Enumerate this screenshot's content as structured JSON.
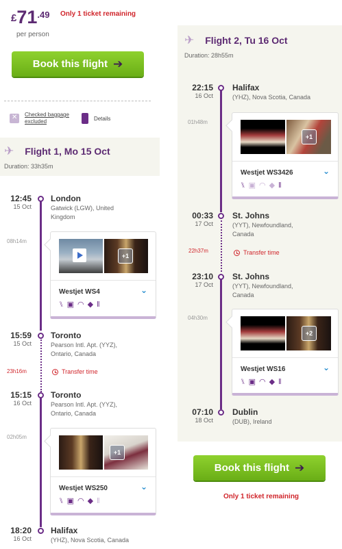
{
  "summary": {
    "currency": "£",
    "price_int": "71",
    "price_dec": ".49",
    "per_person": "per person",
    "remaining": "Only 1 ticket remaining",
    "book_label": "Book this flight",
    "book_arrow": "➔",
    "baggage": "Checked baggage excluded",
    "baggage_line1": "Checked baggage",
    "baggage_line2": "excluded",
    "details": "Details"
  },
  "flight1": {
    "title": "Flight 1, Mo 15 Oct",
    "duration": "Duration: 33h35m",
    "stops": [
      {
        "time": "12:45",
        "date": "15 Oct",
        "city": "London",
        "airport_l1": "Gatwick (LGW), United",
        "airport_l2": "Kingdom"
      },
      {
        "time": "15:59",
        "date": "15 Oct",
        "city": "Toronto",
        "airport_l1": "Pearson Intl. Apt. (YYZ),",
        "airport_l2": "Ontario, Canada"
      },
      {
        "time": "15:15",
        "date": "16 Oct",
        "city": "Toronto",
        "airport_l1": "Pearson Intl. Apt. (YYZ),",
        "airport_l2": "Ontario, Canada"
      },
      {
        "time": "18:20",
        "date": "16 Oct",
        "city": "Halifax",
        "airport_l1": "(YHZ), Nova Scotia, Canada",
        "airport_l2": ""
      }
    ],
    "legs": [
      {
        "duration": "08h14m",
        "airline": "Westjet WS4",
        "extra_photos": "+1"
      },
      {
        "duration": "02h05m",
        "airline": "Westjet WS250",
        "extra_photos": "+1"
      }
    ],
    "transfer": {
      "duration": "23h16m",
      "label": "Transfer time"
    }
  },
  "flight2": {
    "title": "Flight 2, Tu 16 Oct",
    "duration": "Duration: 28h55m",
    "stops": [
      {
        "time": "22:15",
        "date": "16 Oct",
        "city": "Halifax",
        "airport_l1": "(YHZ), Nova Scotia, Canada",
        "airport_l2": ""
      },
      {
        "time": "00:33",
        "date": "17 Oct",
        "city": "St. Johns",
        "airport_l1": "(YYT), Newfoundland,",
        "airport_l2": "Canada"
      },
      {
        "time": "23:10",
        "date": "17 Oct",
        "city": "St. Johns",
        "airport_l1": "(YYT), Newfoundland,",
        "airport_l2": "Canada"
      },
      {
        "time": "07:10",
        "date": "18 Oct",
        "city": "Dublin",
        "airport_l1": "(DUB), Ireland",
        "airport_l2": ""
      }
    ],
    "legs": [
      {
        "duration": "01h48m",
        "airline": "Westjet WS3426",
        "extra_photos": "+1"
      },
      {
        "duration": "04h30m",
        "airline": "Westjet WS16",
        "extra_photos": "+2"
      }
    ],
    "transfer": {
      "duration": "22h37m",
      "label": "Transfer time"
    }
  },
  "amenities": [
    "seat-icon",
    "entertainment-icon",
    "wifi-icon",
    "power-icon",
    "meal-icon"
  ],
  "colors": {
    "brand_purple": "#5c2a72",
    "accent_green": "#7ac023",
    "alert_red": "#d0252b",
    "link_blue": "#2a8fd0"
  }
}
